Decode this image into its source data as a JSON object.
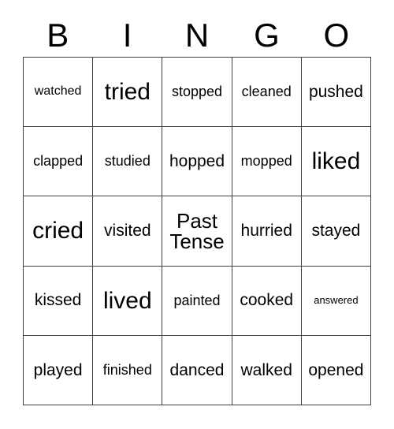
{
  "card": {
    "title_letters": [
      "B",
      "I",
      "N",
      "G",
      "O"
    ],
    "free_space_text": "Past Tense",
    "rows": [
      [
        {
          "label": "watched",
          "size": "sm",
          "free": false
        },
        {
          "label": "tried",
          "size": "xxl",
          "free": false
        },
        {
          "label": "stopped",
          "size": "md",
          "free": false
        },
        {
          "label": "cleaned",
          "size": "md",
          "free": false
        },
        {
          "label": "pushed",
          "size": "lg",
          "free": false
        }
      ],
      [
        {
          "label": "clapped",
          "size": "md",
          "free": false
        },
        {
          "label": "studied",
          "size": "md",
          "free": false
        },
        {
          "label": "hopped",
          "size": "lg",
          "free": false
        },
        {
          "label": "mopped",
          "size": "md",
          "free": false
        },
        {
          "label": "liked",
          "size": "xxl",
          "free": false
        }
      ],
      [
        {
          "label": "cried",
          "size": "xxl",
          "free": false
        },
        {
          "label": "visited",
          "size": "lg",
          "free": false
        },
        {
          "label": "Past Tense",
          "size": "xl",
          "free": true
        },
        {
          "label": "hurried",
          "size": "lg",
          "free": false
        },
        {
          "label": "stayed",
          "size": "lg",
          "free": false
        }
      ],
      [
        {
          "label": "kissed",
          "size": "lg",
          "free": false
        },
        {
          "label": "lived",
          "size": "xxl",
          "free": false
        },
        {
          "label": "painted",
          "size": "md",
          "free": false
        },
        {
          "label": "cooked",
          "size": "lg",
          "free": false
        },
        {
          "label": "answered",
          "size": "xs",
          "free": false
        }
      ],
      [
        {
          "label": "played",
          "size": "lg",
          "free": false
        },
        {
          "label": "finished",
          "size": "md",
          "free": false
        },
        {
          "label": "danced",
          "size": "lg",
          "free": false
        },
        {
          "label": "walked",
          "size": "lg",
          "free": false
        },
        {
          "label": "opened",
          "size": "lg",
          "free": false
        }
      ]
    ]
  },
  "colors": {
    "background": "#ffffff",
    "text": "#000000",
    "grid_line": "#404040"
  }
}
